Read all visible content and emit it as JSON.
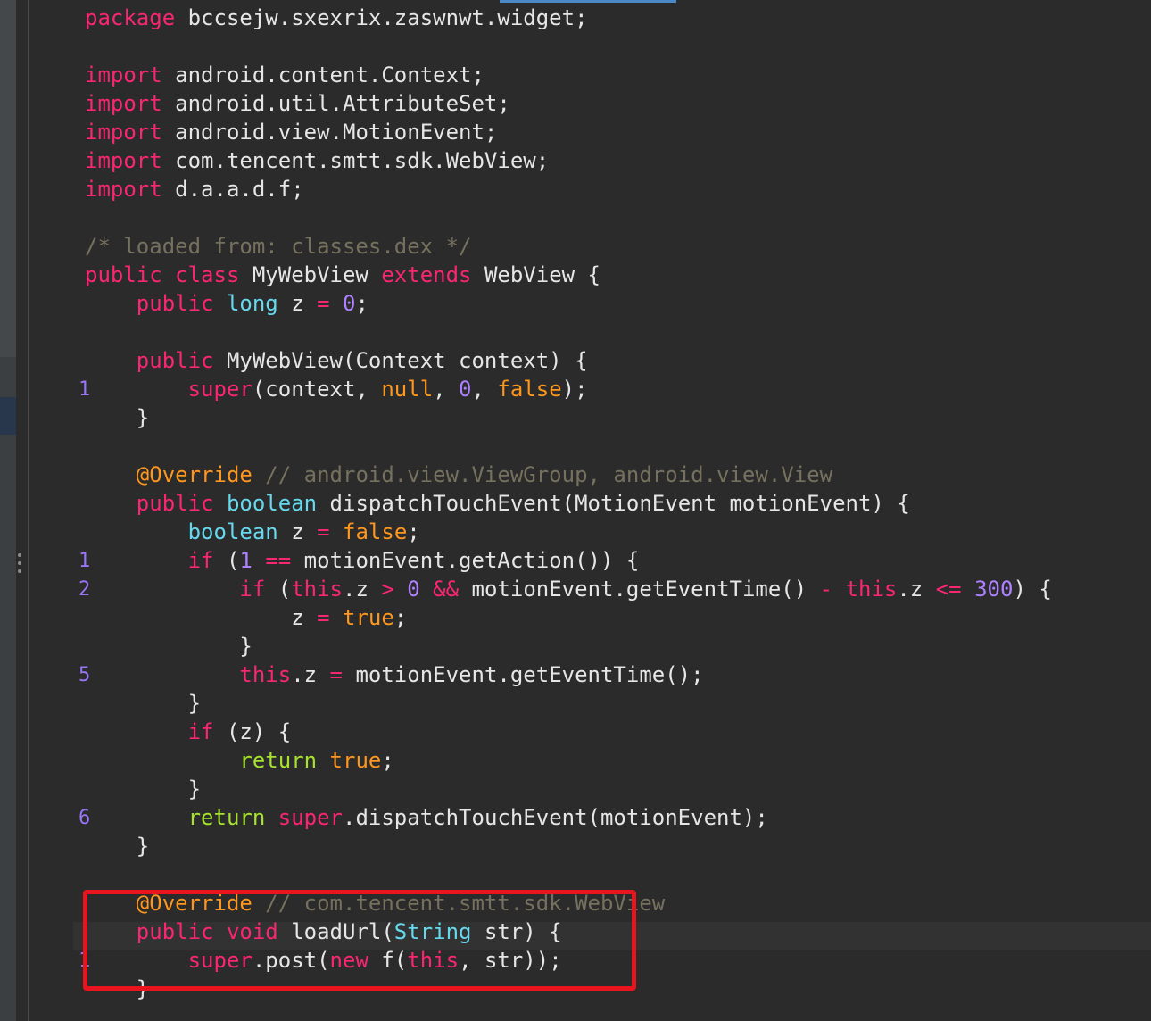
{
  "editor": {
    "line_markers": [
      "1",
      "1",
      "2",
      "5",
      "6",
      "1"
    ],
    "code_lines": [
      [
        {
          "t": "package",
          "c": "k-pink"
        },
        {
          "t": " bccsejw.sxexrix.zaswnwt.widget;",
          "c": "k-plain"
        }
      ],
      [],
      [
        {
          "t": "import",
          "c": "k-pink"
        },
        {
          "t": " android.content.Context;",
          "c": "k-plain"
        }
      ],
      [
        {
          "t": "import",
          "c": "k-pink"
        },
        {
          "t": " android.util.AttributeSet;",
          "c": "k-plain"
        }
      ],
      [
        {
          "t": "import",
          "c": "k-pink"
        },
        {
          "t": " android.view.MotionEvent;",
          "c": "k-plain"
        }
      ],
      [
        {
          "t": "import",
          "c": "k-pink"
        },
        {
          "t": " com.tencent.smtt.sdk.WebView;",
          "c": "k-plain"
        }
      ],
      [
        {
          "t": "import",
          "c": "k-pink"
        },
        {
          "t": " d.a.a.d.f;",
          "c": "k-plain"
        }
      ],
      [],
      [
        {
          "t": "/* loaded from: classes.dex */",
          "c": "k-comment"
        }
      ],
      [
        {
          "t": "public class",
          "c": "k-pink"
        },
        {
          "t": " MyWebView ",
          "c": "k-plain"
        },
        {
          "t": "extends",
          "c": "k-pink"
        },
        {
          "t": " WebView {",
          "c": "k-plain"
        }
      ],
      [
        {
          "t": "    public ",
          "c": "k-pink"
        },
        {
          "t": "long",
          "c": "k-cyan"
        },
        {
          "t": " z ",
          "c": "k-plain"
        },
        {
          "t": "=",
          "c": "k-pink"
        },
        {
          "t": " ",
          "c": "k-plain"
        },
        {
          "t": "0",
          "c": "k-purple"
        },
        {
          "t": ";",
          "c": "k-plain"
        }
      ],
      [],
      [
        {
          "t": "    public",
          "c": "k-pink"
        },
        {
          "t": " MyWebView(Context context) {",
          "c": "k-plain"
        }
      ],
      [
        {
          "t": "        super",
          "c": "k-pink"
        },
        {
          "t": "(context, ",
          "c": "k-plain"
        },
        {
          "t": "null",
          "c": "k-orange"
        },
        {
          "t": ", ",
          "c": "k-plain"
        },
        {
          "t": "0",
          "c": "k-purple"
        },
        {
          "t": ", ",
          "c": "k-plain"
        },
        {
          "t": "false",
          "c": "k-orange"
        },
        {
          "t": ");",
          "c": "k-plain"
        }
      ],
      [
        {
          "t": "    }",
          "c": "k-plain"
        }
      ],
      [],
      [
        {
          "t": "    @Override",
          "c": "k-ann"
        },
        {
          "t": " // android.view.ViewGroup, android.view.View",
          "c": "k-comment"
        }
      ],
      [
        {
          "t": "    public ",
          "c": "k-pink"
        },
        {
          "t": "boolean",
          "c": "k-cyan"
        },
        {
          "t": " dispatchTouchEvent(MotionEvent motionEvent) {",
          "c": "k-plain"
        }
      ],
      [
        {
          "t": "        boolean",
          "c": "k-cyan"
        },
        {
          "t": " z ",
          "c": "k-plain"
        },
        {
          "t": "=",
          "c": "k-pink"
        },
        {
          "t": " ",
          "c": "k-plain"
        },
        {
          "t": "false",
          "c": "k-orange"
        },
        {
          "t": ";",
          "c": "k-plain"
        }
      ],
      [
        {
          "t": "        if",
          "c": "k-pink"
        },
        {
          "t": " (",
          "c": "k-plain"
        },
        {
          "t": "1",
          "c": "k-purple"
        },
        {
          "t": " ",
          "c": "k-plain"
        },
        {
          "t": "==",
          "c": "k-pink"
        },
        {
          "t": " motionEvent.getAction()) {",
          "c": "k-plain"
        }
      ],
      [
        {
          "t": "            if",
          "c": "k-pink"
        },
        {
          "t": " (",
          "c": "k-plain"
        },
        {
          "t": "this",
          "c": "k-pink"
        },
        {
          "t": ".z ",
          "c": "k-plain"
        },
        {
          "t": ">",
          "c": "k-pink"
        },
        {
          "t": " ",
          "c": "k-plain"
        },
        {
          "t": "0",
          "c": "k-purple"
        },
        {
          "t": " ",
          "c": "k-plain"
        },
        {
          "t": "&&",
          "c": "k-pink"
        },
        {
          "t": " motionEvent.getEventTime() ",
          "c": "k-plain"
        },
        {
          "t": "-",
          "c": "k-pink"
        },
        {
          "t": " ",
          "c": "k-plain"
        },
        {
          "t": "this",
          "c": "k-pink"
        },
        {
          "t": ".z ",
          "c": "k-plain"
        },
        {
          "t": "<=",
          "c": "k-pink"
        },
        {
          "t": " ",
          "c": "k-plain"
        },
        {
          "t": "300",
          "c": "k-purple"
        },
        {
          "t": ") {",
          "c": "k-plain"
        }
      ],
      [
        {
          "t": "                z ",
          "c": "k-plain"
        },
        {
          "t": "=",
          "c": "k-pink"
        },
        {
          "t": " ",
          "c": "k-plain"
        },
        {
          "t": "true",
          "c": "k-orange"
        },
        {
          "t": ";",
          "c": "k-plain"
        }
      ],
      [
        {
          "t": "            }",
          "c": "k-plain"
        }
      ],
      [
        {
          "t": "            this",
          "c": "k-pink"
        },
        {
          "t": ".z ",
          "c": "k-plain"
        },
        {
          "t": "=",
          "c": "k-pink"
        },
        {
          "t": " motionEvent.getEventTime();",
          "c": "k-plain"
        }
      ],
      [
        {
          "t": "        }",
          "c": "k-plain"
        }
      ],
      [
        {
          "t": "        if",
          "c": "k-pink"
        },
        {
          "t": " (z) {",
          "c": "k-plain"
        }
      ],
      [
        {
          "t": "            return",
          "c": "k-green"
        },
        {
          "t": " ",
          "c": "k-plain"
        },
        {
          "t": "true",
          "c": "k-orange"
        },
        {
          "t": ";",
          "c": "k-plain"
        }
      ],
      [
        {
          "t": "        }",
          "c": "k-plain"
        }
      ],
      [
        {
          "t": "        return",
          "c": "k-green"
        },
        {
          "t": " ",
          "c": "k-plain"
        },
        {
          "t": "super",
          "c": "k-pink"
        },
        {
          "t": ".dispatchTouchEvent(motionEvent);",
          "c": "k-plain"
        }
      ],
      [
        {
          "t": "    }",
          "c": "k-plain"
        }
      ],
      [],
      [
        {
          "t": "    @Override",
          "c": "k-ann"
        },
        {
          "t": " // com.tencent.smtt.sdk.WebView",
          "c": "k-comment"
        }
      ],
      [
        {
          "t": "    public void",
          "c": "k-pink"
        },
        {
          "t": " loadUrl(",
          "c": "k-plain"
        },
        {
          "t": "String",
          "c": "k-cyan"
        },
        {
          "t": " str) {",
          "c": "k-plain"
        }
      ],
      [
        {
          "t": "        super",
          "c": "k-pink"
        },
        {
          "t": ".post(",
          "c": "k-plain"
        },
        {
          "t": "new",
          "c": "k-pink"
        },
        {
          "t": " f(",
          "c": "k-plain"
        },
        {
          "t": "this",
          "c": "k-pink"
        },
        {
          "t": ", str));",
          "c": "k-plain"
        }
      ],
      [
        {
          "t": "    }",
          "c": "k-plain"
        }
      ]
    ]
  },
  "colors": {
    "background": "#2b2b2b",
    "keyword": "#f92672",
    "type": "#66d9ef",
    "literal": "#fd971f",
    "number": "#ae81ff",
    "comment": "#75715e",
    "highlight_box": "#e8141e"
  }
}
